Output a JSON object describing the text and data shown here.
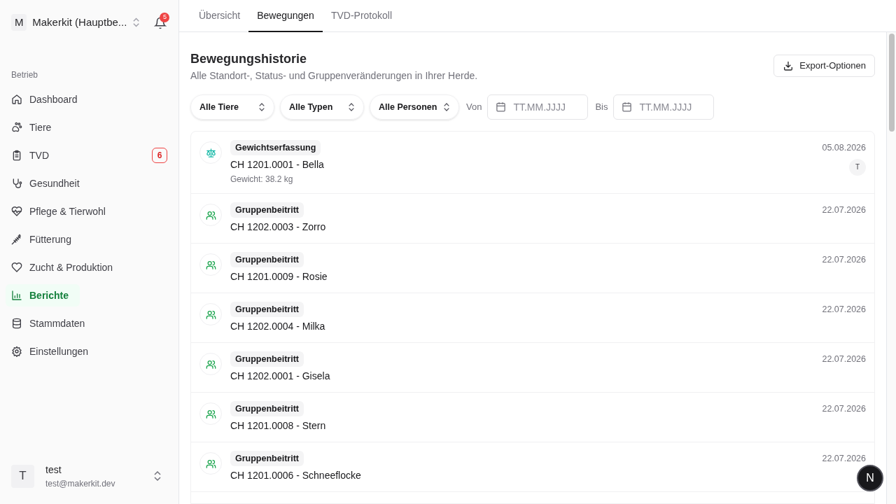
{
  "sidebar": {
    "account": {
      "initial": "M",
      "name": "Makerkit (Hauptbe...",
      "notifications": "5"
    },
    "section_label": "Betrieb",
    "items": [
      {
        "label": "Dashboard",
        "selected": false
      },
      {
        "label": "Tiere",
        "selected": false
      },
      {
        "label": "TVD",
        "selected": false,
        "badge": "6"
      },
      {
        "label": "Gesundheit",
        "selected": false
      },
      {
        "label": "Pflege & Tierwohl",
        "selected": false
      },
      {
        "label": "Fütterung",
        "selected": false
      },
      {
        "label": "Zucht & Produktion",
        "selected": false
      },
      {
        "label": "Berichte",
        "selected": true
      },
      {
        "label": "Stammdaten",
        "selected": false
      },
      {
        "label": "Einstellungen",
        "selected": false
      }
    ],
    "user": {
      "initial": "T",
      "name": "test",
      "email": "test@makerkit.dev"
    }
  },
  "tabs": [
    {
      "label": "Übersicht",
      "selected": false
    },
    {
      "label": "Bewegungen",
      "selected": true
    },
    {
      "label": "TVD-Protokoll",
      "selected": false
    }
  ],
  "header": {
    "title": "Bewegungshistorie",
    "subtitle": "Alle Standort-, Status- und Gruppenveränderungen in Ihrer Herde.",
    "export_button": "Export-Optionen"
  },
  "filters": {
    "selects": [
      "Alle Tiere",
      "Alle Typen",
      "Alle Personen"
    ],
    "from_label": "Von",
    "from_placeholder": "TT.MM.JJJJ",
    "to_label": "Bis",
    "to_placeholder": "TT.MM.JJJJ"
  },
  "movements": [
    {
      "kind": "weight",
      "type": "Gewichtserfassung",
      "animal": "CH 1201.0001 - Bella",
      "detail": "Gewicht: 38.2 kg",
      "date": "05.08.2026",
      "user": "T"
    },
    {
      "kind": "group",
      "type": "Gruppenbeitritt",
      "animal": "CH 1202.0003 - Zorro",
      "date": "22.07.2026"
    },
    {
      "kind": "group",
      "type": "Gruppenbeitritt",
      "animal": "CH 1201.0009 - Rosie",
      "date": "22.07.2026"
    },
    {
      "kind": "group",
      "type": "Gruppenbeitritt",
      "animal": "CH 1202.0004 - Milka",
      "date": "22.07.2026"
    },
    {
      "kind": "group",
      "type": "Gruppenbeitritt",
      "animal": "CH 1202.0001 - Gisela",
      "date": "22.07.2026"
    },
    {
      "kind": "group",
      "type": "Gruppenbeitritt",
      "animal": "CH 1201.0008 - Stern",
      "date": "22.07.2026"
    },
    {
      "kind": "group",
      "type": "Gruppenbeitritt",
      "animal": "CH 1201.0006 - Schneeflocke",
      "date": "22.07.2026"
    }
  ],
  "dev_indicator": "N"
}
